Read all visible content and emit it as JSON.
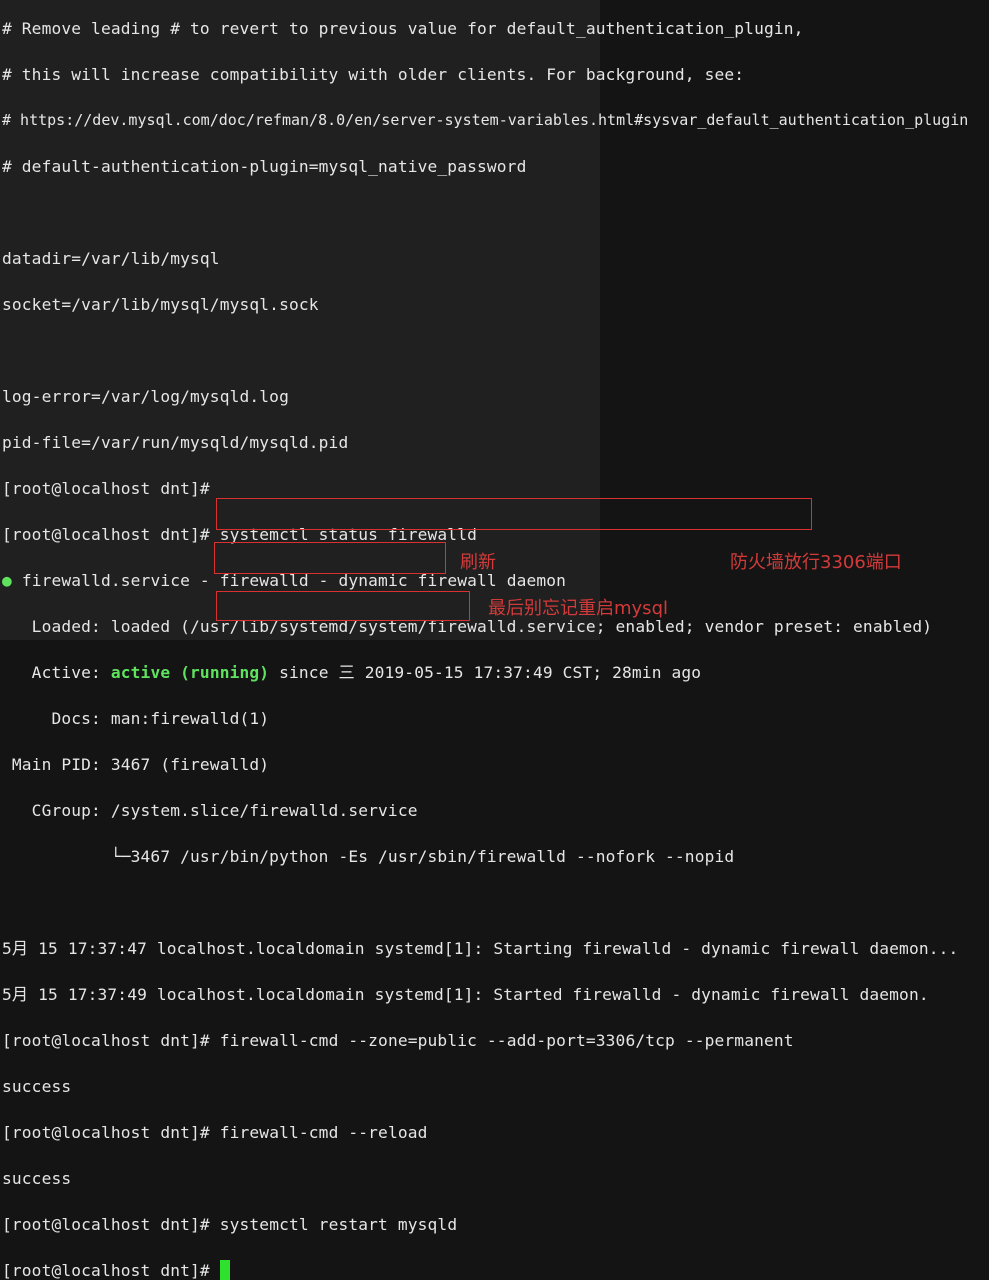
{
  "terminal": {
    "lines": [
      "# Remove leading # to revert to previous value for default_authentication_plugin,",
      "# this will increase compatibility with older clients. For background, see:",
      "# https://dev.mysql.com/doc/refman/8.0/en/server-system-variables.html#sysvar_default_authentication_plugin",
      "# default-authentication-plugin=mysql_native_password",
      "",
      "datadir=/var/lib/mysql",
      "socket=/var/lib/mysql/mysql.sock",
      "",
      "log-error=/var/log/mysqld.log",
      "pid-file=/var/run/mysqld/mysqld.pid",
      "[root@localhost dnt]#",
      "[root@localhost dnt]# systemctl status firewalld",
      "firewalld.service - firewalld - dynamic firewall daemon",
      "   Loaded: loaded (/usr/lib/systemd/system/firewalld.service; enabled; vendor preset: enabled)",
      "since 三 2019-05-15 17:37:49 CST; 28min ago",
      "     Docs: man:firewalld(1)",
      " Main PID: 3467 (firewalld)",
      "   CGroup: /system.slice/firewalld.service",
      "           └─3467 /usr/bin/python -Es /usr/sbin/firewalld --nofork --nopid",
      "",
      "5月 15 17:37:47 localhost.localdomain systemd[1]: Starting firewalld - dynamic firewall daemon...",
      "5月 15 17:37:49 localhost.localdomain systemd[1]: Started firewalld - dynamic firewall daemon.",
      "firewall-cmd --zone=public --add-port=3306/tcp --permanent",
      "success",
      "firewall-cmd --reload",
      "success",
      "systemctl restart mysqld",
      ""
    ],
    "prompt": "[root@localhost dnt]# ",
    "bullet": "●",
    "active_label": "   Active: ",
    "active_status": "active (running)"
  },
  "annotations": {
    "refresh": "刷新",
    "open_port": "防火墙放行3306端口",
    "restart": "最后别忘记重启mysql"
  },
  "colors": {
    "annotation": "#d33a3a",
    "active": "#5fe35f",
    "cursor": "#2fe02f"
  }
}
